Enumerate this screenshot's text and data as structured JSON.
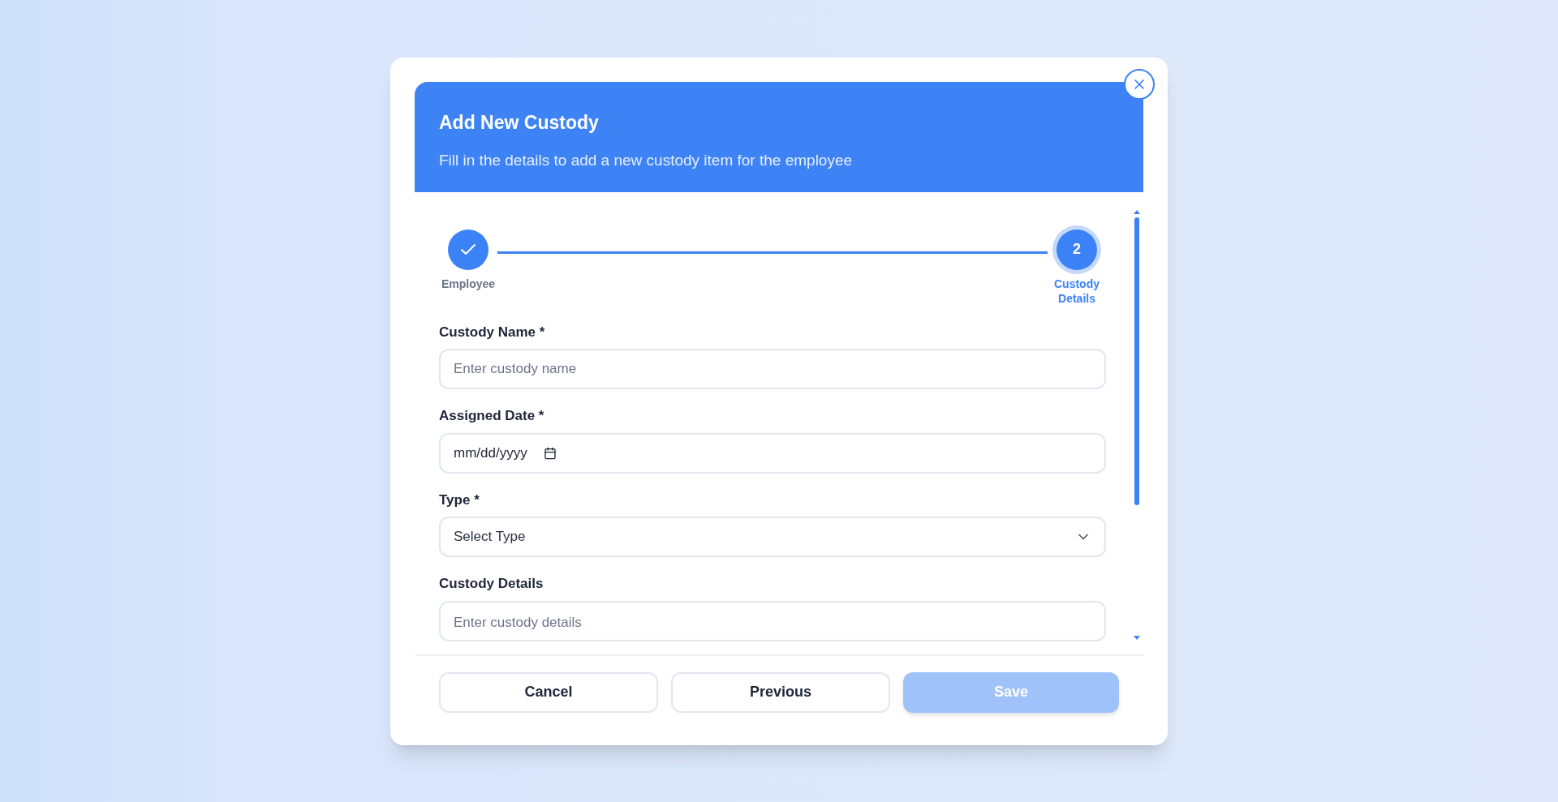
{
  "dialog": {
    "title": "Add New Custody",
    "subtitle": "Fill in the details to add a new custody item for the employee",
    "steps": [
      {
        "label": "Employee",
        "completed": true,
        "selected": false
      },
      {
        "number": "2",
        "label": "Custody Details",
        "completed": false,
        "selected": true
      }
    ],
    "fields": [
      {
        "kind": "text",
        "label": "Custody Name *",
        "placeholder": "Enter custody name"
      },
      {
        "kind": "date",
        "label": "Assigned Date *",
        "placeholder": "mm/dd/yyyy"
      },
      {
        "kind": "select",
        "label": "Type *",
        "value": "Select Type"
      },
      {
        "kind": "textarea",
        "label": "Custody Details",
        "placeholder": "Enter custody details"
      }
    ],
    "buttons": [
      {
        "kind": "outline",
        "label": "Cancel",
        "disabled": false
      },
      {
        "kind": "outline",
        "label": "Previous",
        "disabled": false
      },
      {
        "kind": "primary",
        "label": "Save",
        "disabled": true
      }
    ]
  }
}
